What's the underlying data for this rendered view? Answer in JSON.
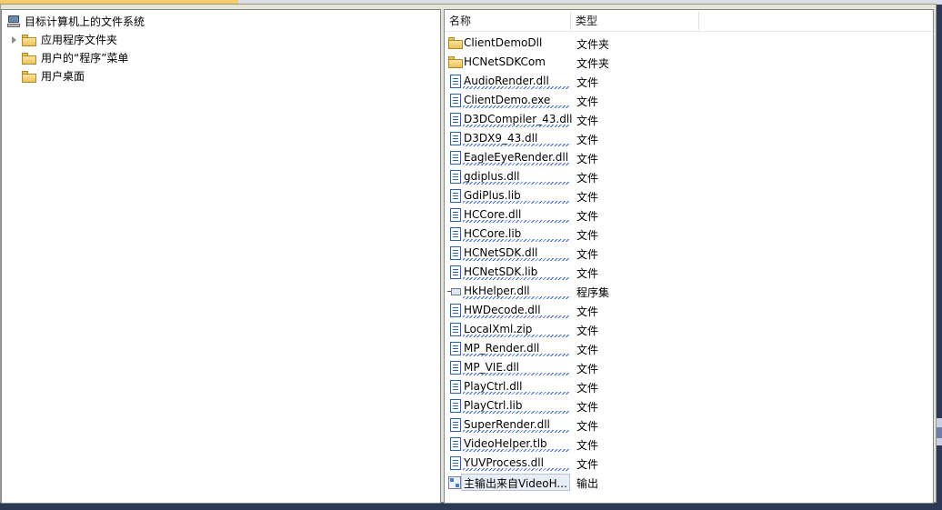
{
  "tree": {
    "root_label": "目标计算机上的文件系统",
    "items": [
      {
        "label": "应用程序文件夹",
        "expandable": true,
        "icon": "folder-icon"
      },
      {
        "label": "用户的“程序”菜单",
        "expandable": false,
        "icon": "folder-icon"
      },
      {
        "label": "用户桌面",
        "expandable": false,
        "icon": "folder-icon"
      }
    ]
  },
  "list": {
    "columns": {
      "name": "名称",
      "type": "类型"
    },
    "rows": [
      {
        "name": "ClientDemoDll",
        "type": "文件夹",
        "icon": "folder-icon"
      },
      {
        "name": "HCNetSDKCom",
        "type": "文件夹",
        "icon": "folder-icon"
      },
      {
        "name": "AudioRender.dll",
        "type": "文件",
        "icon": "file-icon"
      },
      {
        "name": "ClientDemo.exe",
        "type": "文件",
        "icon": "file-icon"
      },
      {
        "name": "D3DCompiler_43.dll",
        "type": "文件",
        "icon": "file-icon"
      },
      {
        "name": "D3DX9_43.dll",
        "type": "文件",
        "icon": "file-icon"
      },
      {
        "name": "EagleEyeRender.dll",
        "type": "文件",
        "icon": "file-icon"
      },
      {
        "name": "gdiplus.dll",
        "type": "文件",
        "icon": "file-icon"
      },
      {
        "name": "GdiPlus.lib",
        "type": "文件",
        "icon": "file-icon"
      },
      {
        "name": "HCCore.dll",
        "type": "文件",
        "icon": "file-icon"
      },
      {
        "name": "HCCore.lib",
        "type": "文件",
        "icon": "file-icon"
      },
      {
        "name": "HCNetSDK.dll",
        "type": "文件",
        "icon": "file-icon"
      },
      {
        "name": "HCNetSDK.lib",
        "type": "文件",
        "icon": "file-icon"
      },
      {
        "name": "HkHelper.dll",
        "type": "程序集",
        "icon": "assembly-icon"
      },
      {
        "name": "HWDecode.dll",
        "type": "文件",
        "icon": "file-icon"
      },
      {
        "name": "LocalXml.zip",
        "type": "文件",
        "icon": "file-icon"
      },
      {
        "name": "MP_Render.dll",
        "type": "文件",
        "icon": "file-icon"
      },
      {
        "name": "MP_VIE.dll",
        "type": "文件",
        "icon": "file-icon"
      },
      {
        "name": "PlayCtrl.dll",
        "type": "文件",
        "icon": "file-icon"
      },
      {
        "name": "PlayCtrl.lib",
        "type": "文件",
        "icon": "file-icon"
      },
      {
        "name": "SuperRender.dll",
        "type": "文件",
        "icon": "file-icon"
      },
      {
        "name": "VideoHelper.tlb",
        "type": "文件",
        "icon": "file-icon"
      },
      {
        "name": "YUVProcess.dll",
        "type": "文件",
        "icon": "file-icon"
      },
      {
        "name": "主输出来自VideoH...",
        "type": "输出",
        "icon": "project-output-icon"
      }
    ]
  },
  "colors": {
    "squiggle": "#3b66d6",
    "selection": "#e9eef6",
    "file_icon_border": "#2b5fb5",
    "folder": "#eac25a"
  }
}
